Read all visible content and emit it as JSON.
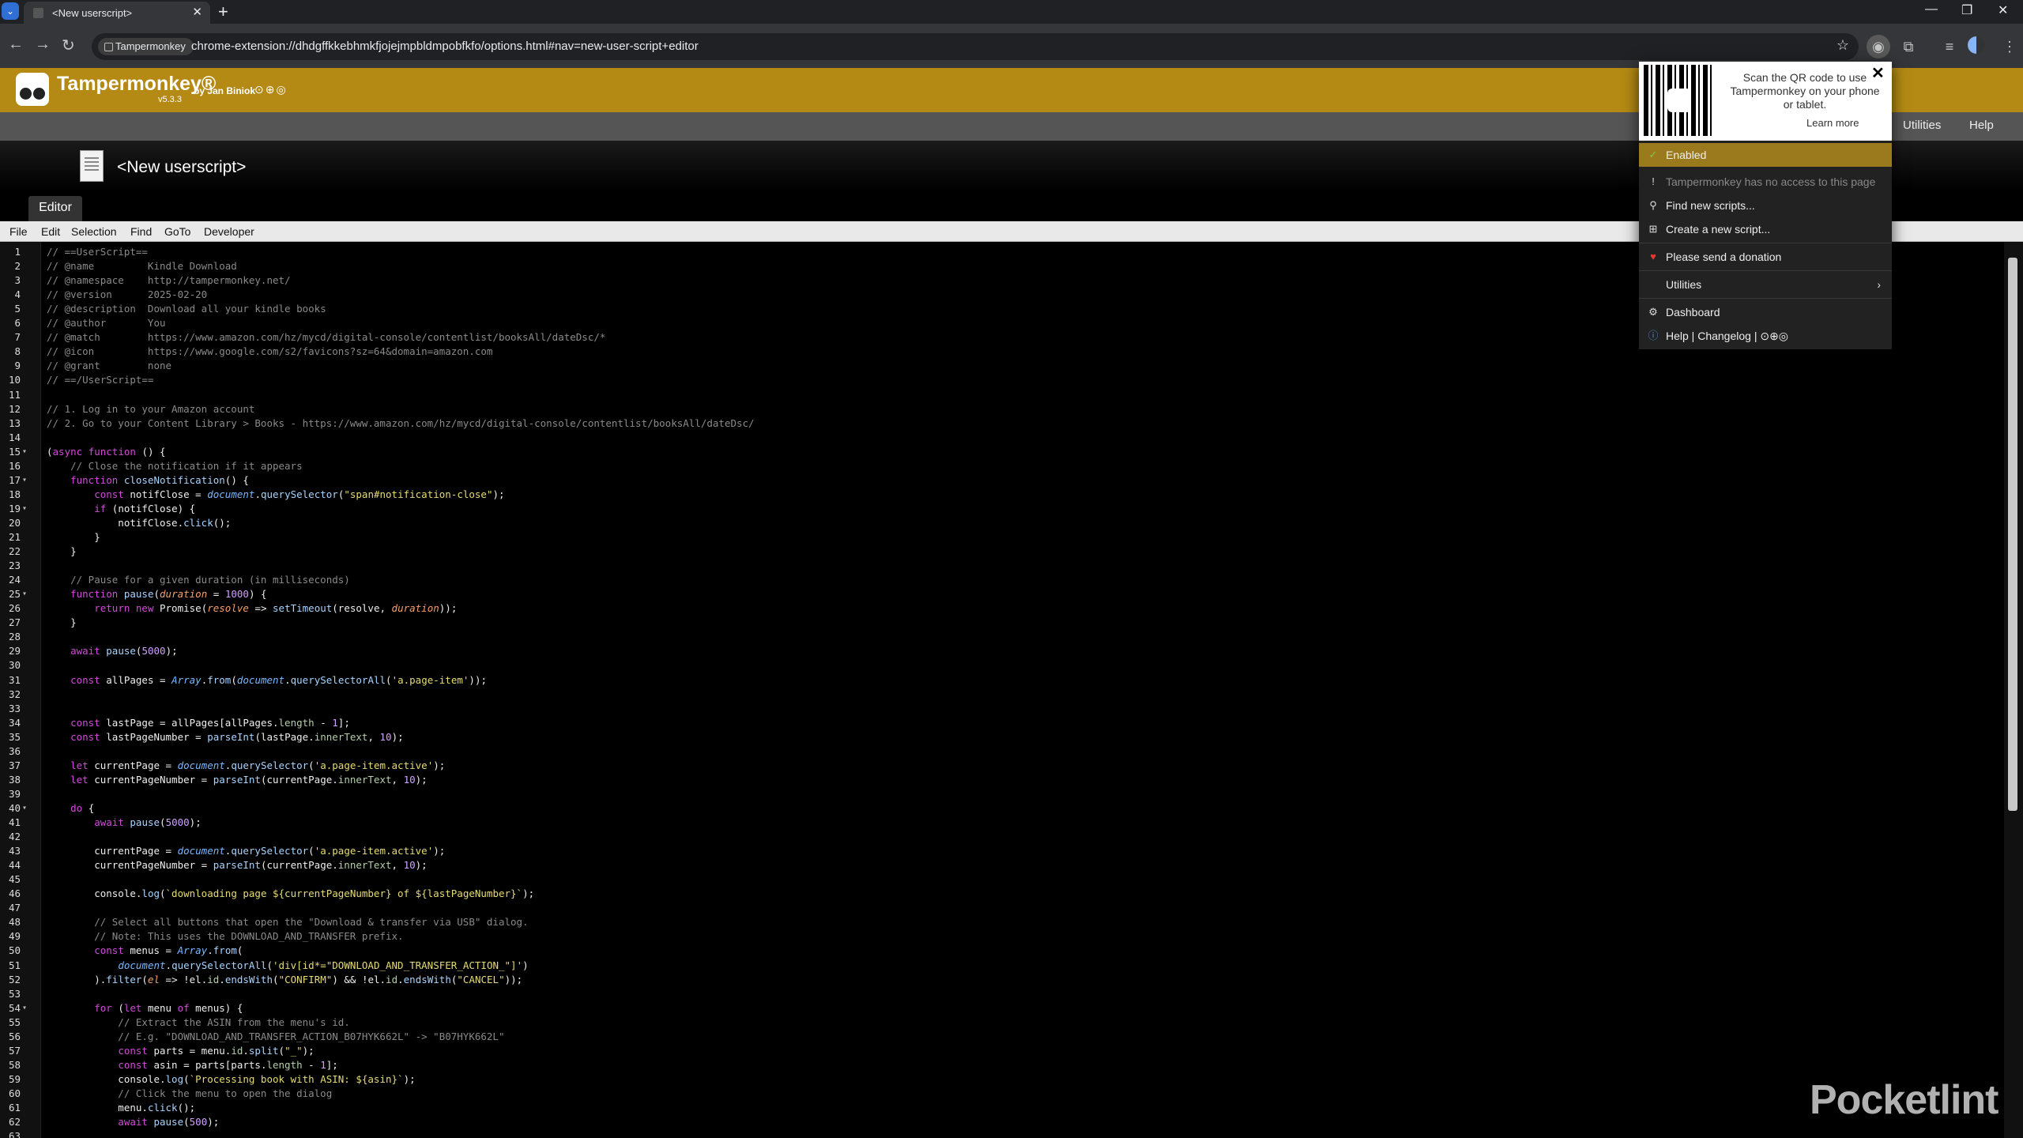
{
  "browser": {
    "tab_title": "<New userscript>",
    "new_tab_symbol": "+",
    "site_chip": "Tampermonkey",
    "url": "chrome-extension://dhdgffkkebhmkfjojejmpbldmpobfkfo/options.html#nav=new-user-script+editor"
  },
  "header": {
    "app_name": "Tampermonkey®",
    "version": "v5.3.3",
    "author": "by Jan Biniok",
    "social": "⊙⊕◎"
  },
  "subnav": {
    "utilities": "Utilities",
    "help": "Help"
  },
  "script": {
    "title": "<New userscript>"
  },
  "tabs": {
    "editor": "Editor"
  },
  "menubar": [
    "File",
    "Edit",
    "Selection",
    "Find",
    "GoTo",
    "Developer"
  ],
  "popup": {
    "qr_text": "Scan the QR code to use Tampermonkey on your phone or tablet.",
    "learn_more": "Learn more",
    "enabled": "Enabled",
    "no_access": "Tampermonkey has no access to this page",
    "find_scripts": "Find new scripts...",
    "create_script": "Create a new script...",
    "donation": "Please send a donation",
    "utilities": "Utilities",
    "dashboard": "Dashboard",
    "help_changelog": "Help | Changelog | ⊙⊕◎"
  },
  "watermark": "Pocketlint",
  "code_lines": [
    {
      "n": 1,
      "t": "// ==UserScript=="
    },
    {
      "n": 2,
      "t": "// @name         Kindle Download"
    },
    {
      "n": 3,
      "t": "// @namespace    http://tampermonkey.net/"
    },
    {
      "n": 4,
      "t": "// @version      2025-02-20"
    },
    {
      "n": 5,
      "t": "// @description  Download all your kindle books"
    },
    {
      "n": 6,
      "t": "// @author       You"
    },
    {
      "n": 7,
      "t": "// @match        https://www.amazon.com/hz/mycd/digital-console/contentlist/booksAll/dateDsc/*"
    },
    {
      "n": 8,
      "t": "// @icon         https://www.google.com/s2/favicons?sz=64&domain=amazon.com"
    },
    {
      "n": 9,
      "t": "// @grant        none"
    },
    {
      "n": 10,
      "t": "// ==/UserScript=="
    },
    {
      "n": 11,
      "t": ""
    },
    {
      "n": 12,
      "t": "// 1. Log in to your Amazon account"
    },
    {
      "n": 13,
      "t": "// 2. Go to your Content Library > Books - https://www.amazon.com/hz/mycd/digital-console/contentlist/booksAll/dateDsc/"
    },
    {
      "n": 14,
      "t": ""
    },
    {
      "n": 15,
      "t": "(async function () {",
      "f": true
    },
    {
      "n": 16,
      "t": "    // Close the notification if it appears"
    },
    {
      "n": 17,
      "t": "    function closeNotification() {",
      "f": true
    },
    {
      "n": 18,
      "t": "        const notifClose = document.querySelector(\"span#notification-close\");"
    },
    {
      "n": 19,
      "t": "        if (notifClose) {",
      "f": true
    },
    {
      "n": 20,
      "t": "            notifClose.click();"
    },
    {
      "n": 21,
      "t": "        }"
    },
    {
      "n": 22,
      "t": "    }"
    },
    {
      "n": 23,
      "t": ""
    },
    {
      "n": 24,
      "t": "    // Pause for a given duration (in milliseconds)"
    },
    {
      "n": 25,
      "t": "    function pause(duration = 1000) {",
      "f": true
    },
    {
      "n": 26,
      "t": "        return new Promise(resolve => setTimeout(resolve, duration));"
    },
    {
      "n": 27,
      "t": "    }"
    },
    {
      "n": 28,
      "t": ""
    },
    {
      "n": 29,
      "t": "    await pause(5000);"
    },
    {
      "n": 30,
      "t": ""
    },
    {
      "n": 31,
      "t": "    const allPages = Array.from(document.querySelectorAll('a.page-item'));"
    },
    {
      "n": 32,
      "t": ""
    },
    {
      "n": 33,
      "t": ""
    },
    {
      "n": 34,
      "t": "    const lastPage = allPages[allPages.length - 1];"
    },
    {
      "n": 35,
      "t": "    const lastPageNumber = parseInt(lastPage.innerText, 10);"
    },
    {
      "n": 36,
      "t": ""
    },
    {
      "n": 37,
      "t": "    let currentPage = document.querySelector('a.page-item.active');"
    },
    {
      "n": 38,
      "t": "    let currentPageNumber = parseInt(currentPage.innerText, 10);"
    },
    {
      "n": 39,
      "t": ""
    },
    {
      "n": 40,
      "t": "    do {",
      "f": true
    },
    {
      "n": 41,
      "t": "        await pause(5000);"
    },
    {
      "n": 42,
      "t": ""
    },
    {
      "n": 43,
      "t": "        currentPage = document.querySelector('a.page-item.active');"
    },
    {
      "n": 44,
      "t": "        currentPageNumber = parseInt(currentPage.innerText, 10);"
    },
    {
      "n": 45,
      "t": ""
    },
    {
      "n": 46,
      "t": "        console.log(`downloading page ${currentPageNumber} of ${lastPageNumber}`);"
    },
    {
      "n": 47,
      "t": ""
    },
    {
      "n": 48,
      "t": "        // Select all buttons that open the \"Download & transfer via USB\" dialog."
    },
    {
      "n": 49,
      "t": "        // Note: This uses the DOWNLOAD_AND_TRANSFER prefix."
    },
    {
      "n": 50,
      "t": "        const menus = Array.from("
    },
    {
      "n": 51,
      "t": "            document.querySelectorAll('div[id*=\"DOWNLOAD_AND_TRANSFER_ACTION_\"]')"
    },
    {
      "n": 52,
      "t": "        ).filter(el => !el.id.endsWith(\"CONFIRM\") && !el.id.endsWith(\"CANCEL\"));"
    },
    {
      "n": 53,
      "t": ""
    },
    {
      "n": 54,
      "t": "        for (let menu of menus) {",
      "f": true
    },
    {
      "n": 55,
      "t": "            // Extract the ASIN from the menu's id."
    },
    {
      "n": 56,
      "t": "            // E.g. \"DOWNLOAD_AND_TRANSFER_ACTION_B07HYK662L\" -> \"B07HYK662L\""
    },
    {
      "n": 57,
      "t": "            const parts = menu.id.split(\"_\");"
    },
    {
      "n": 58,
      "t": "            const asin = parts[parts.length - 1];"
    },
    {
      "n": 59,
      "t": "            console.log(`Processing book with ASIN: ${asin}`);"
    },
    {
      "n": 60,
      "t": "            // Click the menu to open the dialog"
    },
    {
      "n": 61,
      "t": "            menu.click();"
    },
    {
      "n": 62,
      "t": "            await pause(500);"
    },
    {
      "n": 63,
      "t": ""
    }
  ]
}
